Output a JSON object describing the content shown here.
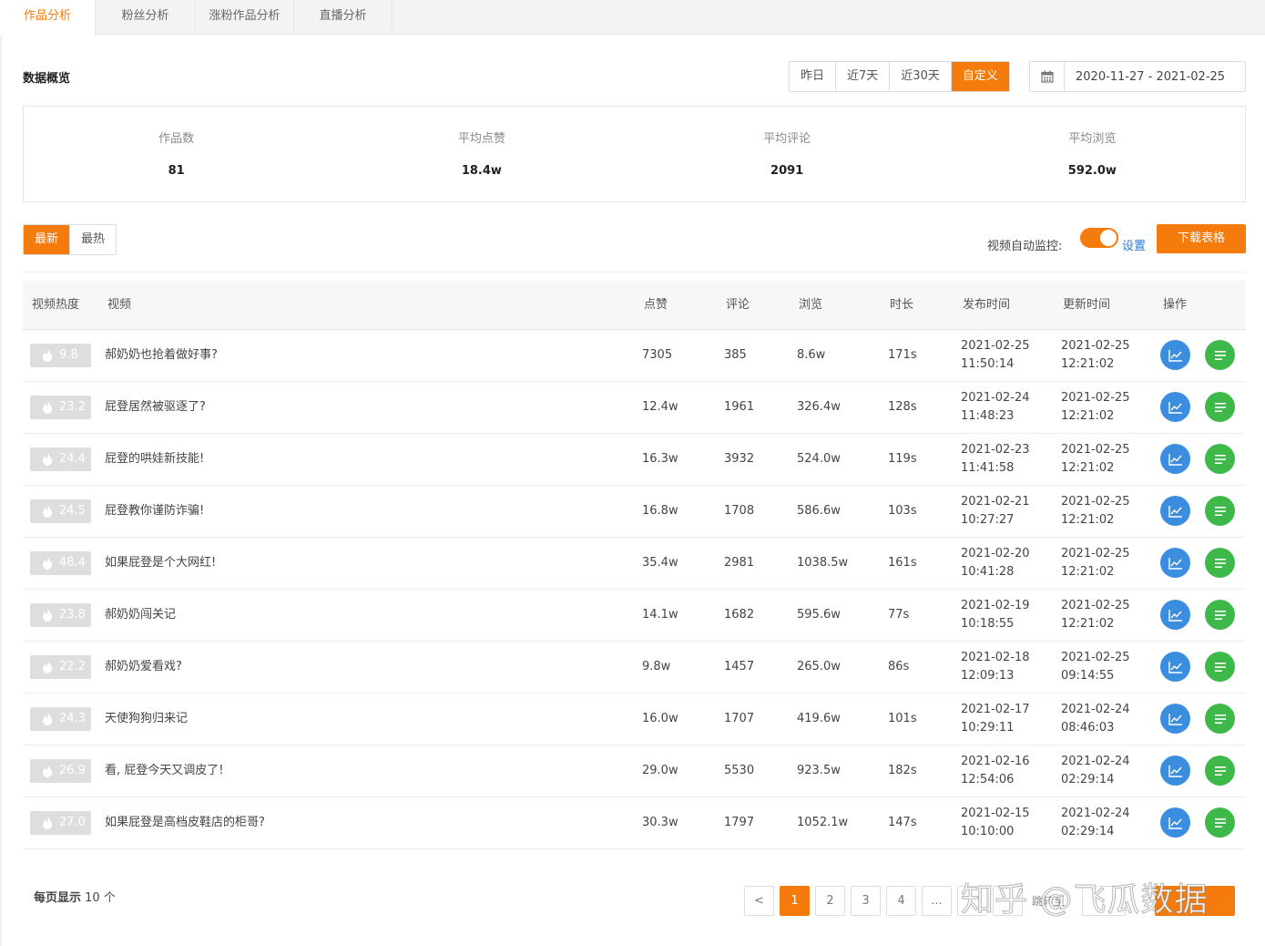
{
  "tabs": [
    "作品分析",
    "粉丝分析",
    "涨粉作品分析",
    "直播分析"
  ],
  "overview": {
    "title": "数据概览",
    "ranges": [
      "昨日",
      "近7天",
      "近30天",
      "自定义"
    ],
    "active_range": "自定义",
    "date_range": "2020-11-27 - 2021-02-25",
    "stats": [
      {
        "label": "作品数",
        "value": "81"
      },
      {
        "label": "平均点赞",
        "value": "18.4w"
      },
      {
        "label": "平均评论",
        "value": "2091"
      },
      {
        "label": "平均浏览",
        "value": "592.0w"
      }
    ]
  },
  "toolbar": {
    "sort": [
      "最新",
      "最热"
    ],
    "active_sort": "最新",
    "monitor_label": "视频自动监控:",
    "monitor_on": true,
    "settings_label": "设置",
    "download_label": "下载表格"
  },
  "table": {
    "headers": [
      "视频热度",
      "视频",
      "点赞",
      "评论",
      "浏览",
      "时长",
      "发布时间",
      "更新时间",
      "操作"
    ],
    "rows": [
      {
        "heat": "9.8",
        "title": "郝奶奶也抢着做好事?",
        "likes": "7305",
        "comments": "385",
        "views": "8.6w",
        "duration": "171s",
        "pub_date": "2021-02-25",
        "pub_time": "11:50:14",
        "upd_date": "2021-02-25",
        "upd_time": "12:21:02"
      },
      {
        "heat": "23.2",
        "title": "屁登居然被驱逐了?",
        "likes": "12.4w",
        "comments": "1961",
        "views": "326.4w",
        "duration": "128s",
        "pub_date": "2021-02-24",
        "pub_time": "11:48:23",
        "upd_date": "2021-02-25",
        "upd_time": "12:21:02"
      },
      {
        "heat": "24.4",
        "title": "屁登的哄娃新技能!",
        "likes": "16.3w",
        "comments": "3932",
        "views": "524.0w",
        "duration": "119s",
        "pub_date": "2021-02-23",
        "pub_time": "11:41:58",
        "upd_date": "2021-02-25",
        "upd_time": "12:21:02"
      },
      {
        "heat": "24.5",
        "title": "屁登教你谨防诈骗!",
        "likes": "16.8w",
        "comments": "1708",
        "views": "586.6w",
        "duration": "103s",
        "pub_date": "2021-02-21",
        "pub_time": "10:27:27",
        "upd_date": "2021-02-25",
        "upd_time": "12:21:02"
      },
      {
        "heat": "48.4",
        "title": "如果屁登是个大网红!",
        "likes": "35.4w",
        "comments": "2981",
        "views": "1038.5w",
        "duration": "161s",
        "pub_date": "2021-02-20",
        "pub_time": "10:41:28",
        "upd_date": "2021-02-25",
        "upd_time": "12:21:02"
      },
      {
        "heat": "23.8",
        "title": "郝奶奶闯关记",
        "likes": "14.1w",
        "comments": "1682",
        "views": "595.6w",
        "duration": "77s",
        "pub_date": "2021-02-19",
        "pub_time": "10:18:55",
        "upd_date": "2021-02-25",
        "upd_time": "12:21:02"
      },
      {
        "heat": "22.2",
        "title": "郝奶奶爱看戏?",
        "likes": "9.8w",
        "comments": "1457",
        "views": "265.0w",
        "duration": "86s",
        "pub_date": "2021-02-18",
        "pub_time": "12:09:13",
        "upd_date": "2021-02-25",
        "upd_time": "09:14:55"
      },
      {
        "heat": "24.3",
        "title": "天使狗狗归来记",
        "likes": "16.0w",
        "comments": "1707",
        "views": "419.6w",
        "duration": "101s",
        "pub_date": "2021-02-17",
        "pub_time": "10:29:11",
        "upd_date": "2021-02-24",
        "upd_time": "08:46:03"
      },
      {
        "heat": "26.9",
        "title": "看, 屁登今天又调皮了!",
        "likes": "29.0w",
        "comments": "5530",
        "views": "923.5w",
        "duration": "182s",
        "pub_date": "2021-02-16",
        "pub_time": "12:54:06",
        "upd_date": "2021-02-24",
        "upd_time": "02:29:14"
      },
      {
        "heat": "27.0",
        "title": "如果屁登是高档皮鞋店的柜哥?",
        "likes": "30.3w",
        "comments": "1797",
        "views": "1052.1w",
        "duration": "147s",
        "pub_date": "2021-02-15",
        "pub_time": "10:10:00",
        "upd_date": "2021-02-24",
        "upd_time": "02:29:14"
      }
    ]
  },
  "pagination": {
    "per_page_prefix": "每页显示",
    "per_page_value": "10 个",
    "prev": "<",
    "pages": [
      "1",
      "2",
      "3",
      "4",
      "..."
    ],
    "active_page": "1",
    "jump_label": "跳转至"
  },
  "watermark": "知乎 @飞瓜数据",
  "colors": {
    "accent": "#f47b0c",
    "chart_action": "#3b8de0",
    "detail_action": "#3fb84a",
    "link": "#2a7bd6"
  }
}
